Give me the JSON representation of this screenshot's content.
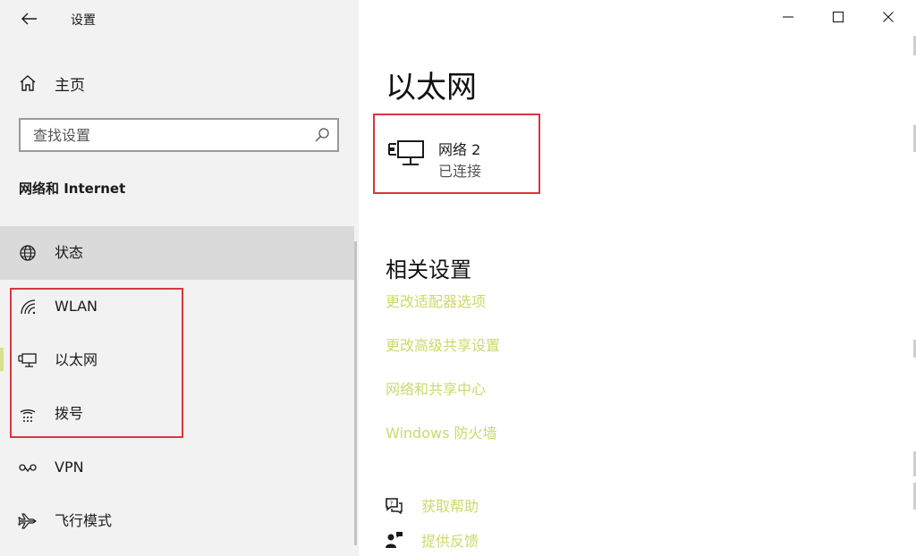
{
  "app": {
    "title": "设置"
  },
  "sidebar": {
    "home_label": "主页",
    "search_placeholder": "查找设置",
    "section_title": "网络和 Internet",
    "items": [
      {
        "label": "状态",
        "icon": "globe-icon",
        "state": "hover"
      },
      {
        "label": "WLAN",
        "icon": "wifi-icon"
      },
      {
        "label": "以太网",
        "icon": "ethernet-icon",
        "state": "selected"
      },
      {
        "label": "拨号",
        "icon": "dial-up-icon"
      },
      {
        "label": "VPN",
        "icon": "vpn-icon"
      },
      {
        "label": "飞行模式",
        "icon": "airplane-icon"
      }
    ]
  },
  "main": {
    "page_title": "以太网",
    "network": {
      "name": "网络 2",
      "status": "已连接",
      "icon": "ethernet-icon"
    },
    "related_title": "相关设置",
    "links": [
      "更改适配器选项",
      "更改高级共享设置",
      "网络和共享中心",
      "Windows 防火墙"
    ],
    "help": [
      {
        "label": "获取帮助",
        "icon": "help-chat-icon"
      },
      {
        "label": "提供反馈",
        "icon": "feedback-icon"
      }
    ]
  },
  "colors": {
    "accent_link": "#cdd96a",
    "highlight_border": "#d9363e",
    "sidebar_bg": "#f2f2f2",
    "selected_indicator": "#d7e28a"
  }
}
